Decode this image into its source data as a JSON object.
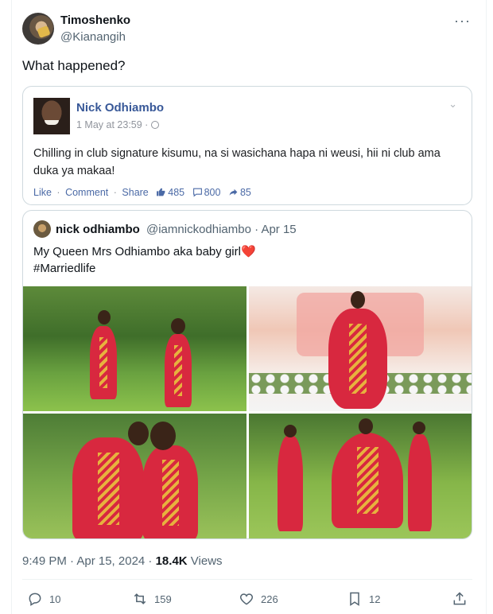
{
  "tweet": {
    "author_name": "Timoshenko",
    "author_handle": "@Kianangih",
    "more_icon": "more-icon",
    "text": "What happened?",
    "timestamp": "9:49 PM · Apr 15, 2024 · ",
    "views_count": "18.4K",
    "views_label": " Views"
  },
  "facebook_card": {
    "name": "Nick Odhiambo",
    "date": "1 May at 23:59 ·",
    "text": "Chilling in club signature kisumu, na si wasichana hapa ni weusi, hii ni club ama duka ya makaa!",
    "like": "Like",
    "comment": "Comment",
    "share": "Share",
    "separator": "·",
    "likes": "485",
    "comments": "800",
    "shares": "85"
  },
  "quoted_tweet": {
    "name": "nick odhiambo",
    "handle": "@iamnickodhiambo · Apr 15",
    "line1": "My Queen Mrs Odhiambo aka baby girl",
    "heart": "❤️",
    "line2": "#Marriedlife"
  },
  "actions": {
    "replies": "10",
    "retweets": "159",
    "likes": "226",
    "bookmarks": "12"
  }
}
